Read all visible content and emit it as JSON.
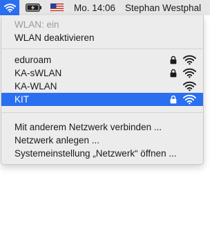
{
  "menubar": {
    "clock": "Mo. 14:06",
    "user": "Stephan Westphal",
    "icons": [
      "wifi-icon",
      "battery-charging-icon",
      "us-flag-icon"
    ]
  },
  "wifi_menu": {
    "status": "WLAN: ein",
    "toggle": "WLAN deaktivieren",
    "networks": [
      {
        "name": "eduroam",
        "locked": true,
        "signal": "full"
      },
      {
        "name": "KA-sWLAN",
        "locked": true,
        "signal": "full"
      },
      {
        "name": "KA-WLAN",
        "locked": false,
        "signal": "full"
      },
      {
        "name": "KIT",
        "locked": true,
        "signal": "full",
        "selected": true
      }
    ],
    "actions": [
      "Mit anderem Netzwerk verbinden ...",
      "Netzwerk anlegen ...",
      "Systemeinstellung „Netzwerk“ öffnen ..."
    ]
  },
  "colors": {
    "accent": "#2a6ff0",
    "menu_bg": "#ececec",
    "menubar_bg": "#e6e6e6",
    "disabled_text": "#9a9a9a"
  }
}
